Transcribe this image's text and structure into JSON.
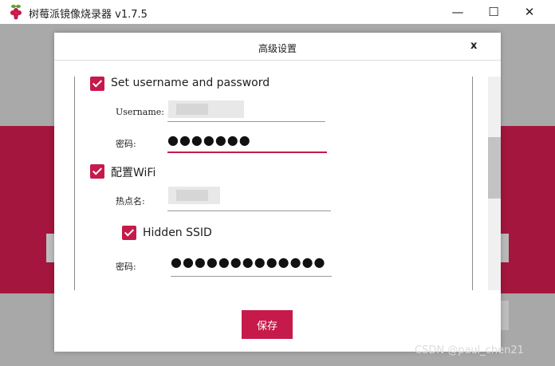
{
  "window": {
    "title": "树莓派镜像烧录器 v1.7.5",
    "minimize_glyph": "—",
    "maximize_glyph": "☐",
    "close_glyph": "✕"
  },
  "dialog": {
    "title": "高级设置",
    "close_label": "x",
    "username_section": {
      "checkbox_label": "Set username and password",
      "checked": true,
      "username_label": "Username:",
      "password_label": "密码:",
      "password_mask": "●●●●●●●"
    },
    "wifi_section": {
      "checkbox_label": "配置WiFi",
      "checked": true,
      "ssid_label": "热点名:",
      "hidden_ssid_label": "Hidden SSID",
      "hidden_ssid_checked": true,
      "password_label": "密码:",
      "password_mask": "●●●●●●●●●●●●●"
    },
    "save_label": "保存"
  },
  "colors": {
    "accent": "#c51a4a",
    "dim_background": "#a4163d"
  },
  "watermark": "CSDN @paul_chen21"
}
